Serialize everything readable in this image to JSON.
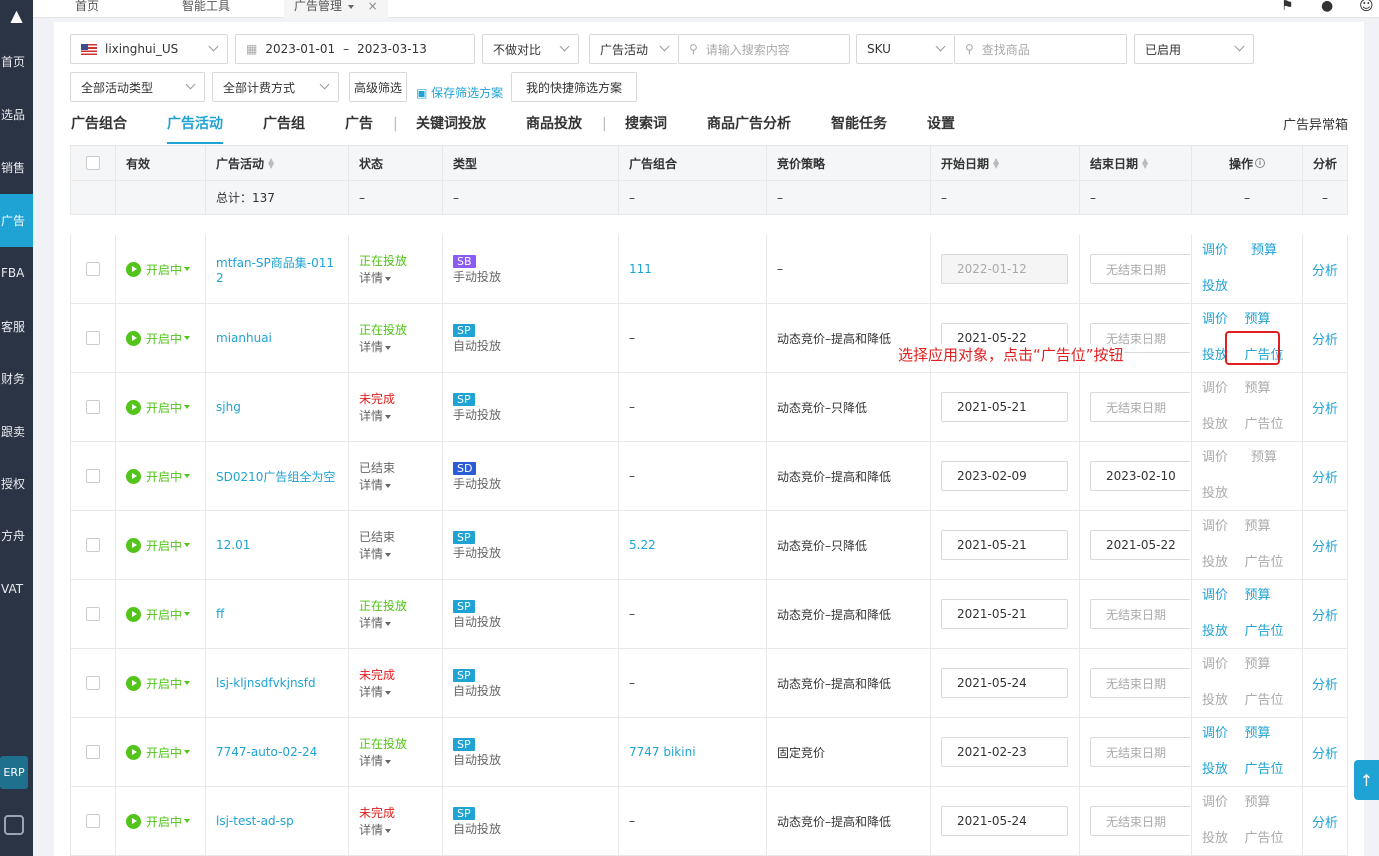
{
  "sidebar": {
    "items": [
      "首页",
      "选品",
      "销售",
      "广告",
      "FBA",
      "客服",
      "财务",
      "跟卖",
      "授权",
      "方舟",
      "VAT"
    ],
    "active": "广告",
    "erp": "ERP"
  },
  "topbar": {
    "tabs": [
      "首页",
      "智能工具",
      "广告管理"
    ],
    "close": "×"
  },
  "filters": {
    "account": "lixinghui_US",
    "date_start": "2023-01-01",
    "date_sep": "–",
    "date_end": "2023-03-13",
    "compare": "不做对比",
    "search_scope": "广告活动",
    "search_placeholder": "请输入搜索内容",
    "sku": "SKU",
    "product_placeholder": "查找商品",
    "enabled": "已启用",
    "activity_type": "全部活动类型",
    "billing": "全部计费方式",
    "advanced": "高级筛选",
    "save_plan": "保存筛选方案",
    "my_plans": "我的快捷筛选方案"
  },
  "nav": {
    "tabs": [
      "广告组合",
      "广告活动",
      "广告组",
      "广告",
      "关键词投放",
      "商品投放",
      "搜索词",
      "商品广告分析",
      "智能任务",
      "设置"
    ],
    "active": "广告活动",
    "abnormal": "广告异常箱"
  },
  "table": {
    "headers": [
      "有效",
      "广告活动",
      "状态",
      "类型",
      "广告组合",
      "竞价策略",
      "开始日期",
      "结束日期",
      "操作",
      "分析"
    ],
    "summary": {
      "total": "总计：137",
      "dash": "–"
    },
    "rows": [
      {
        "valid": "开启中",
        "name": "mtfan-SP商品集-011",
        "name2": "2",
        "status": "正在投放",
        "status_color": "green",
        "detail": "详情",
        "badge": "SB",
        "ttype": "手动投放",
        "portfolio": "111",
        "bid": "–",
        "start": "2022-01-12",
        "start_disabled": true,
        "end": "无结束日期",
        "end_ph": true,
        "ops": [
          "调价",
          "预算",
          "投放",
          ""
        ],
        "ops_on": true,
        "analyze": "分析"
      },
      {
        "valid": "开启中",
        "name": "mianhuai",
        "name2": "",
        "status": "正在投放",
        "status_color": "green",
        "detail": "详情",
        "badge": "SP",
        "ttype": "自动投放",
        "portfolio": "–",
        "bid": "动态竞价–提高和降低",
        "start": "2021-05-22",
        "start_disabled": false,
        "end": "无结束日期",
        "end_ph": true,
        "ops": [
          "调价",
          "预算",
          "投放",
          "广告位"
        ],
        "ops_on": true,
        "analyze": "分析"
      },
      {
        "valid": "开启中",
        "name": "sjhg",
        "name2": "",
        "status": "未完成",
        "status_color": "red",
        "detail": "详情",
        "badge": "SP",
        "ttype": "手动投放",
        "portfolio": "–",
        "bid": "动态竞价–只降低",
        "start": "2021-05-21",
        "start_disabled": false,
        "end": "无结束日期",
        "end_ph": true,
        "ops": [
          "调价",
          "预算",
          "投放",
          "广告位"
        ],
        "ops_on": false,
        "analyze": "分析"
      },
      {
        "valid": "开启中",
        "name": "SD0210广告组全为空",
        "name2": "",
        "status": "已结束",
        "status_color": "gray",
        "detail": "详情",
        "badge": "SD",
        "ttype": "手动投放",
        "portfolio": "–",
        "bid": "动态竞价–提高和降低",
        "start": "2023-02-09",
        "start_disabled": false,
        "end": "2023-02-10",
        "end_ph": false,
        "ops": [
          "调价",
          "预算",
          "投放",
          ""
        ],
        "ops_on": false,
        "analyze": "分析"
      },
      {
        "valid": "开启中",
        "name": "12.01",
        "name2": "",
        "status": "已结束",
        "status_color": "gray",
        "detail": "详情",
        "badge": "SP",
        "ttype": "手动投放",
        "portfolio": "5.22",
        "bid": "动态竞价–只降低",
        "start": "2021-05-21",
        "start_disabled": false,
        "end": "2021-05-22",
        "end_ph": false,
        "ops": [
          "调价",
          "预算",
          "投放",
          "广告位"
        ],
        "ops_on": false,
        "analyze": "分析"
      },
      {
        "valid": "开启中",
        "name": "ff",
        "name2": "",
        "status": "正在投放",
        "status_color": "green",
        "detail": "详情",
        "badge": "SP",
        "ttype": "自动投放",
        "portfolio": "–",
        "bid": "动态竞价–提高和降低",
        "start": "2021-05-21",
        "start_disabled": false,
        "end": "无结束日期",
        "end_ph": true,
        "ops": [
          "调价",
          "预算",
          "投放",
          "广告位"
        ],
        "ops_on": true,
        "analyze": "分析"
      },
      {
        "valid": "开启中",
        "name": "lsj-kljnsdfvkjnsfd",
        "name2": "",
        "status": "未完成",
        "status_color": "red",
        "detail": "详情",
        "badge": "SP",
        "ttype": "自动投放",
        "portfolio": "–",
        "bid": "动态竞价–提高和降低",
        "start": "2021-05-24",
        "start_disabled": false,
        "end": "无结束日期",
        "end_ph": true,
        "ops": [
          "调价",
          "预算",
          "投放",
          "广告位"
        ],
        "ops_on": false,
        "analyze": "分析"
      },
      {
        "valid": "开启中",
        "name": "7747-auto-02-24",
        "name2": "",
        "status": "正在投放",
        "status_color": "green",
        "detail": "详情",
        "badge": "SP",
        "ttype": "自动投放",
        "portfolio": "7747 bikini",
        "bid": "固定竞价",
        "start": "2021-02-23",
        "start_disabled": false,
        "end": "无结束日期",
        "end_ph": true,
        "ops": [
          "调价",
          "预算",
          "投放",
          "广告位"
        ],
        "ops_on": true,
        "analyze": "分析"
      },
      {
        "valid": "开启中",
        "name": "lsj-test-ad-sp",
        "name2": "",
        "status": "未完成",
        "status_color": "red",
        "detail": "详情",
        "badge": "SP",
        "ttype": "自动投放",
        "portfolio": "–",
        "bid": "动态竞价–提高和降低",
        "start": "2021-05-24",
        "start_disabled": false,
        "end": "无结束日期",
        "end_ph": true,
        "ops": [
          "调价",
          "预算",
          "投放",
          "广告位"
        ],
        "ops_on": false,
        "analyze": "分析"
      }
    ]
  },
  "annotation": "选择应用对象，点击“广告位”按钮",
  "colors": {
    "accent": "#1fa3d4",
    "green": "#52c41a",
    "red": "#e02020",
    "sidebar": "#2b3444"
  }
}
